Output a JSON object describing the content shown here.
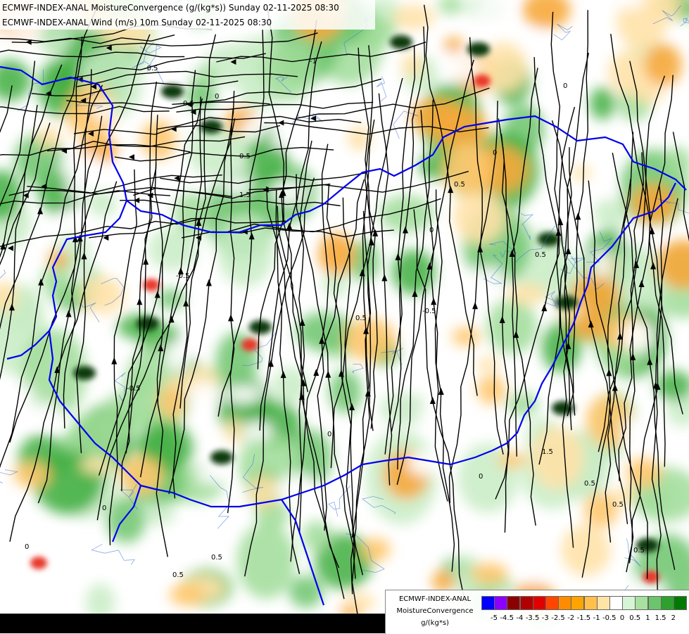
{
  "header": {
    "line1": "ECMWF-INDEX-ANAL MoistureConvergence (g/(kg*s)) Sunday 02-11-2025 08:30",
    "line2": "ECMWF-INDEX-ANAL Wind (m/s) 10m Sunday 02-11-2025 08:30"
  },
  "legend": {
    "title1": "ECMWF-INDEX-ANAL",
    "title2": "MoistureConvergence",
    "units": "g/(kg*s)",
    "bins": [
      {
        "color": "#0000ff"
      },
      {
        "color": "#8b00ff"
      },
      {
        "color": "#8b0000"
      },
      {
        "color": "#b00000"
      },
      {
        "color": "#e00000"
      },
      {
        "color": "#ff4500"
      },
      {
        "color": "#ff8c00"
      },
      {
        "color": "#ffa500"
      },
      {
        "color": "#ffc04c"
      },
      {
        "color": "#ffe4a8"
      },
      {
        "color": "#ffffff"
      },
      {
        "color": "#d6f5d6"
      },
      {
        "color": "#a8e0a0"
      },
      {
        "color": "#6cc46c"
      },
      {
        "color": "#2ea02e"
      },
      {
        "color": "#007a00"
      }
    ],
    "ticks": [
      "-5",
      "-4.5",
      "-4",
      "-3.5",
      "-3",
      "-2.5",
      "-2",
      "-1.5",
      "-1",
      "-0.5",
      "0",
      "0.5",
      "1",
      "1.5",
      "2"
    ]
  },
  "map": {
    "contour_labels": [
      "0.5",
      "-0.5",
      "0",
      "-1",
      "1.5",
      "0.5",
      "0",
      "-0.5",
      "0.5",
      "0",
      "0.5",
      "-0.5",
      "0.5",
      "0",
      "0",
      "0.5",
      "1.5",
      "0.5",
      "0.5",
      "0",
      "0.5",
      "0",
      "0",
      "0.5",
      "-0.5"
    ]
  }
}
